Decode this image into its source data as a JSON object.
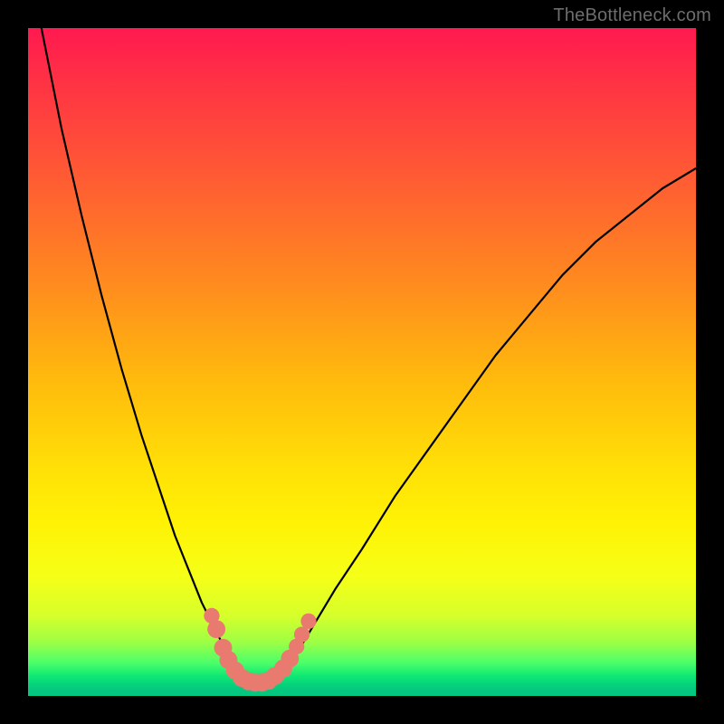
{
  "watermark": "TheBottleneck.com",
  "colors": {
    "frame": "#000000",
    "gradient_top": "#ff1950",
    "gradient_mid": "#ffe007",
    "gradient_bottom": "#04c780",
    "curve": "#000000",
    "marker": "#e97a6f"
  },
  "chart_data": {
    "type": "line",
    "title": "",
    "xlabel": "",
    "ylabel": "",
    "xlim": [
      0,
      100
    ],
    "ylim": [
      0,
      100
    ],
    "x": [
      0,
      2,
      5,
      8,
      11,
      14,
      17,
      20,
      22,
      24,
      26,
      28,
      29,
      30,
      31,
      32,
      33,
      34,
      35,
      36,
      38,
      40,
      43,
      46,
      50,
      55,
      60,
      65,
      70,
      75,
      80,
      85,
      90,
      95,
      100
    ],
    "values": [
      120,
      100,
      85,
      72,
      60,
      49,
      39,
      30,
      24,
      19,
      14,
      10,
      8,
      6,
      4.5,
      3.2,
      2.3,
      2.0,
      2.0,
      2.3,
      3.5,
      6,
      11,
      16,
      22,
      30,
      37,
      44,
      51,
      57,
      63,
      68,
      72,
      76,
      79
    ],
    "markers": [
      {
        "x": 27.5,
        "y": 12.0,
        "r": 1.3
      },
      {
        "x": 28.2,
        "y": 10.0,
        "r": 1.5
      },
      {
        "x": 29.2,
        "y": 7.2,
        "r": 1.5
      },
      {
        "x": 30.0,
        "y": 5.4,
        "r": 1.5
      },
      {
        "x": 31.0,
        "y": 3.8,
        "r": 1.5
      },
      {
        "x": 32.0,
        "y": 2.7,
        "r": 1.5
      },
      {
        "x": 33.0,
        "y": 2.2,
        "r": 1.5
      },
      {
        "x": 34.0,
        "y": 2.0,
        "r": 1.5
      },
      {
        "x": 35.0,
        "y": 2.0,
        "r": 1.5
      },
      {
        "x": 36.0,
        "y": 2.3,
        "r": 1.5
      },
      {
        "x": 37.0,
        "y": 3.0,
        "r": 1.5
      },
      {
        "x": 38.2,
        "y": 4.1,
        "r": 1.5
      },
      {
        "x": 39.2,
        "y": 5.6,
        "r": 1.5
      },
      {
        "x": 40.2,
        "y": 7.4,
        "r": 1.3
      },
      {
        "x": 41.0,
        "y": 9.2,
        "r": 1.3
      },
      {
        "x": 42.0,
        "y": 11.2,
        "r": 1.3
      }
    ],
    "note": "y-axis inverted in render: 0 at bottom, values go up. Left branch runs off top of plot."
  }
}
